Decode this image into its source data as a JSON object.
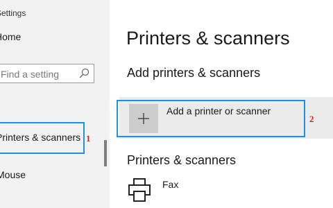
{
  "sidebar": {
    "title": "Settings",
    "home_label": "Home",
    "search_placeholder": "Find a setting",
    "active_item_label": "Printers & scanners",
    "bottom_item_label": "Mouse"
  },
  "main": {
    "title": "Printers & scanners",
    "add_section_title": "Add printers & scanners",
    "add_button_label": "Add a printer or scanner",
    "devices_section_title": "Printers & scanners",
    "devices": [
      {
        "name": "Fax",
        "icon": "printer-icon"
      }
    ]
  },
  "annotations": {
    "marker_1": "1",
    "marker_2": "2"
  },
  "colors": {
    "sidebar_bg": "#f2f2f2",
    "highlight_border": "#1e90e0",
    "marker_text": "#d42020",
    "add_row_bg": "#ebebeb"
  }
}
